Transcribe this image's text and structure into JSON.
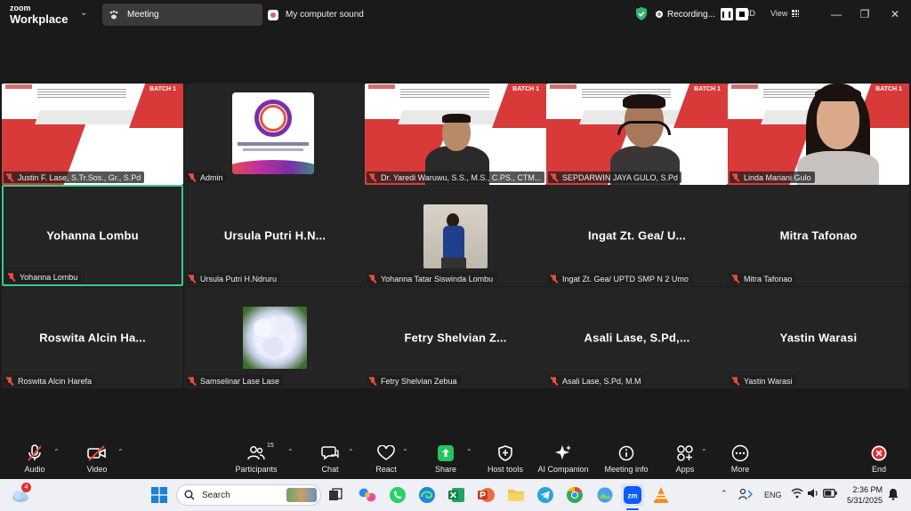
{
  "titlebar": {
    "logo_line1": "zoom",
    "logo_line2": "Workplace",
    "tab_meeting": "Meeting",
    "tab_sound": "My computer sound",
    "recording": "Recording...",
    "id_label": "ID",
    "view_label": "View"
  },
  "tiles": [
    {
      "label": "Justin F. Lase, S.Tr.Sos., Gr., S.Pd"
    },
    {
      "label": "Admin"
    },
    {
      "label": "Dr. Yaredi Waruwu, S.S., M.S., C.PS., CTM..."
    },
    {
      "label": "SEPDARWIN JAYA GULO, S.Pd"
    },
    {
      "label": "Linda Mariani Gulo"
    },
    {
      "big": "Yohanna Lombu",
      "label": "Yohanna Lombu"
    },
    {
      "big": "Ursula Putri H.N...",
      "label": "Ursula Putri H.Ndruru"
    },
    {
      "label": "Yohanna Tatar Siswinda Lombu"
    },
    {
      "big": "Ingat Zt. Gea/ U...",
      "label": "Ingat Zt. Gea/ UPTD SMP N 2 Umo"
    },
    {
      "big": "Mitra Tafonao",
      "label": "Mitra Tafonao"
    },
    {
      "big": "Roswita Alcin Ha...",
      "label": "Roswita Alcin Harefa"
    },
    {
      "label": "Samselinar Lase Lase"
    },
    {
      "big": "Fetry Shelvian Z...",
      "label": "Fetry Shelvian Zebua"
    },
    {
      "big": "Asali  Lase, S.Pd,...",
      "label": "Asali  Lase, S.Pd, M.M"
    },
    {
      "big": "Yastin Warasi",
      "label": "Yastin Warasi"
    }
  ],
  "slide_batch": "BATCH 1",
  "toolbar": {
    "audio": "Audio",
    "video": "Video",
    "participants": "Participants",
    "participants_count": "15",
    "chat": "Chat",
    "react": "React",
    "share": "Share",
    "host_tools": "Host tools",
    "ai_companion": "AI Companion",
    "meeting_info": "Meeting info",
    "apps": "Apps",
    "more": "More",
    "end": "End"
  },
  "taskbar": {
    "search_placeholder": "Search",
    "weather_badge": "4",
    "lang": "ENG",
    "time": "2:36 PM",
    "date": "5/31/2025"
  },
  "colors": {
    "active_border": "#3fc98a",
    "share_green": "#22c55e",
    "end_red": "#e02f2f",
    "muted_red": "#e74c3c"
  }
}
